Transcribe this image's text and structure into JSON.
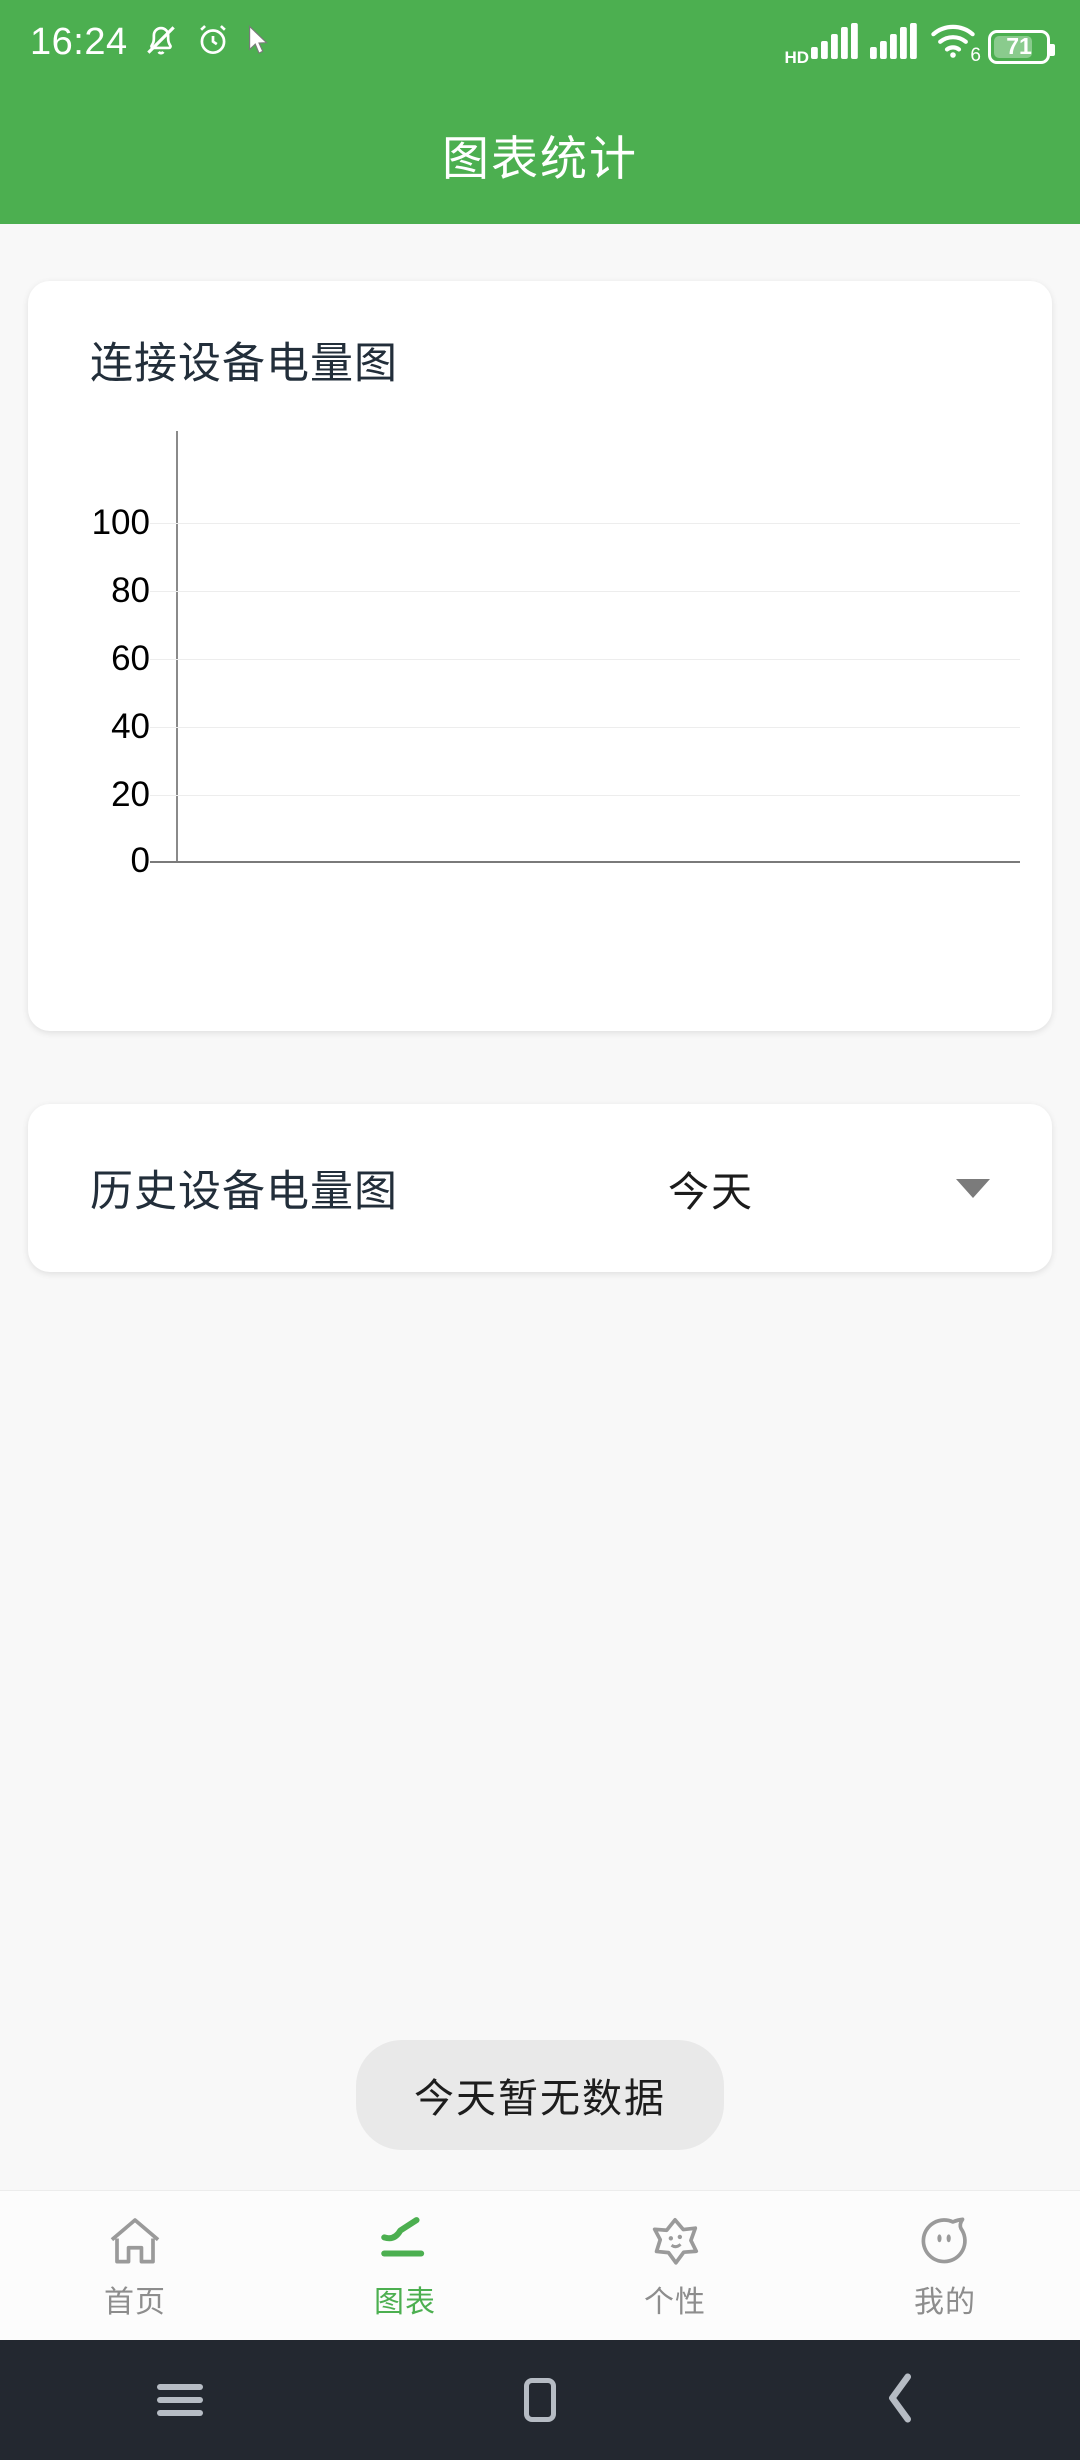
{
  "status_bar": {
    "time": "16:24",
    "icons_left": [
      "mute-bell-icon",
      "alarm-clock-icon",
      "cursor-icon"
    ],
    "network_tag": "HD",
    "icons_right": [
      "signal-bars-1-icon",
      "signal-bars-2-icon",
      "wifi-6-icon"
    ],
    "wifi_generation": "6",
    "battery_percent": "71"
  },
  "app_bar": {
    "title": "图表统计",
    "background_color": "#4caf50"
  },
  "battery_card": {
    "title": "连接设备电量图"
  },
  "history_card": {
    "title": "历史设备电量图",
    "selected_range": "今天",
    "caret": "chevron-down-icon"
  },
  "toast": {
    "message": "今天暂无数据"
  },
  "tab_bar": {
    "active_color": "#4caf50",
    "inactive_color": "#8d8d8d",
    "items": [
      {
        "label": "首页",
        "icon": "home-icon",
        "active": false
      },
      {
        "label": "图表",
        "icon": "chart-line-icon",
        "active": true
      },
      {
        "label": "个性",
        "icon": "star-icon",
        "active": false
      },
      {
        "label": "我的",
        "icon": "profile-face-icon",
        "active": false
      }
    ]
  },
  "android_nav": {
    "buttons": [
      "recents-menu-icon",
      "home-square-icon",
      "back-chevron-icon"
    ]
  },
  "chart_data": {
    "type": "line",
    "title": "连接设备电量图",
    "xlabel": "",
    "ylabel": "",
    "ylim": [
      0,
      100
    ],
    "yticks": [
      100,
      80,
      60,
      40,
      20,
      0
    ],
    "ytick_labels": [
      "100",
      "80",
      "60",
      "40",
      "20",
      "0"
    ],
    "categories": [],
    "series": [],
    "grid": true,
    "legend": false,
    "empty": true
  }
}
